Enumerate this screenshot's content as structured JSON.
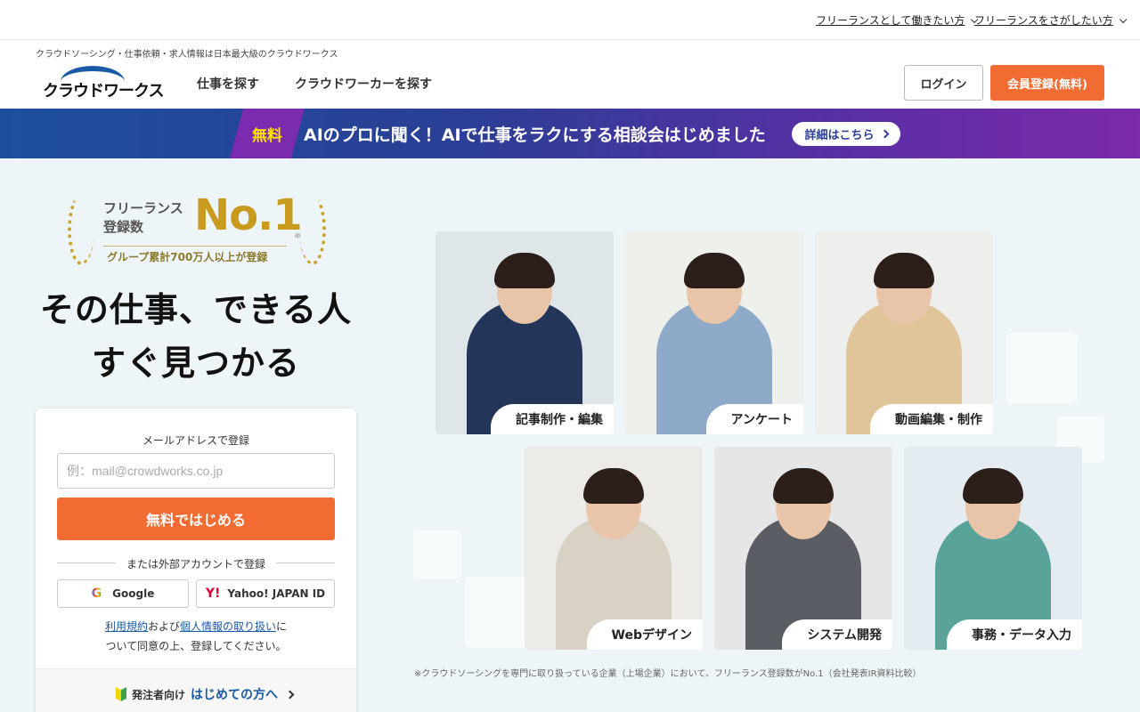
{
  "util_bar": {
    "link1": "フリーランスとして働きたい方",
    "link2": "フリーランスをさがしたい方"
  },
  "header": {
    "tagline": "クラウドソーシング・仕事依頼・求人情報は日本最大級のクラウドワークス",
    "logo_text": "クラウドワークス",
    "nav_find_jobs": "仕事を探す",
    "nav_find_workers": "クラウドワーカーを探す",
    "login": "ログイン",
    "register": "会員登録(無料)"
  },
  "banner": {
    "badge": "無料",
    "text": "AIのプロに聞く！AIで仕事をラクにする相談会はじめました",
    "button": "詳細はこちら"
  },
  "award": {
    "label_line1": "フリーランス",
    "label_line2": "登録数",
    "rank": "No.1",
    "star": "※",
    "subtext": "グループ累計700万人以上が登録"
  },
  "headline": {
    "line1": "その仕事、できる人",
    "line2": "すぐ見つかる"
  },
  "signup": {
    "email_label": "メールアドレスで登録",
    "email_placeholder": "例：mail@crowdworks.co.jp",
    "email_value": "",
    "start_button": "無料ではじめる",
    "divider": "または外部アカウントで登録",
    "google": "Google",
    "google_glyph": "G",
    "yahoo": "Yahoo! JAPAN ID",
    "yahoo_glyph": "Y!",
    "terms_link": "利用規約",
    "terms_and": "および",
    "privacy_link": "個人情報の取り扱い",
    "terms_tail1": "に",
    "terms_tail2": "ついて同意の上、登録してください。",
    "footer_prefix": "発注者向け",
    "footer_link": "はじめての方へ"
  },
  "tiles": [
    {
      "label": "記事制作・編集",
      "bg": "#dfe6ea",
      "shirt": "#23365a"
    },
    {
      "label": "アンケート",
      "bg": "#eef0ec",
      "shirt": "#8fa9c9"
    },
    {
      "label": "動画編集・制作",
      "bg": "#eeeeec",
      "shirt": "#e0c59a"
    },
    {
      "label": "Webデザイン",
      "bg": "#ecebe8",
      "shirt": "#d9d2c4"
    },
    {
      "label": "システム開発",
      "bg": "#e6e6e6",
      "shirt": "#5a5d63"
    },
    {
      "label": "事務・データ入力",
      "bg": "#e4ecf2",
      "shirt": "#5aa39a"
    }
  ],
  "footnote": "※クラウドソーシングを専門に取り扱っている企業（上場企業）において、フリーランス登録数がNo.1（会社発表IR資料比較）",
  "colors": {
    "accent_orange": "#f26b32",
    "brand_blue": "#1a5aa6",
    "banner_yellow": "#ffe100",
    "gold": "#c89a1e"
  }
}
